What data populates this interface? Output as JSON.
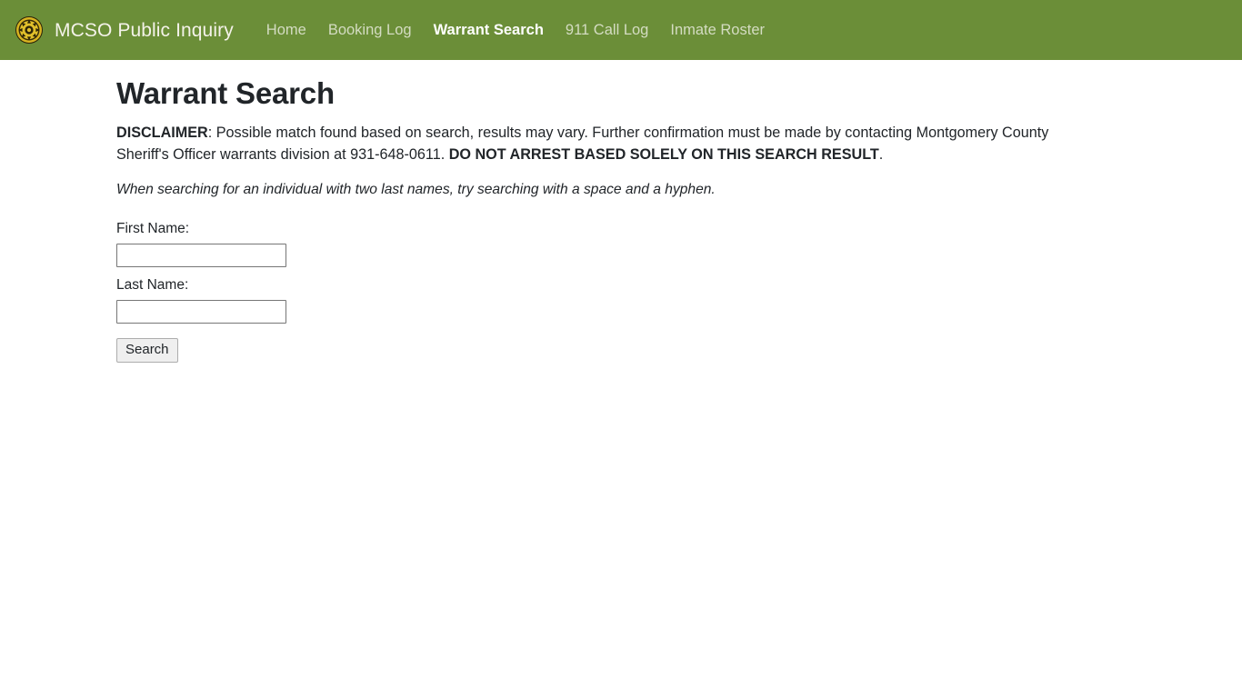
{
  "colors": {
    "navbar_bg": "#6b8e38",
    "brand_text": "#f4f2e9",
    "nav_link": "#d4dcc2",
    "nav_link_active": "#ffffff",
    "logo_gold": "#d8b421",
    "logo_dark": "#2c2408",
    "body_text": "#212529",
    "input_border": "#767676",
    "button_bg": "#efefef"
  },
  "navbar": {
    "brand": "MCSO Public Inquiry",
    "logo_icon": "sheriff-badge-seal-icon",
    "links": [
      {
        "label": "Home",
        "active": false
      },
      {
        "label": "Booking Log",
        "active": false
      },
      {
        "label": "Warrant Search",
        "active": true
      },
      {
        "label": "911 Call Log",
        "active": false
      },
      {
        "label": "Inmate Roster",
        "active": false
      }
    ]
  },
  "main": {
    "title": "Warrant Search",
    "disclaimer": {
      "label": "DISCLAIMER",
      "body_part1": ": Possible match found based on search, results may vary. Further confirmation must be made by contacting Montgomery County Sheriff's Officer warrants division at 931-648-0611. ",
      "warning": "DO NOT ARREST BASED SOLELY ON THIS SEARCH RESULT",
      "body_part2": "."
    },
    "hint": "When searching for an individual with two last names, try searching with a space and a hyphen.",
    "form": {
      "first_name_label": "First Name:",
      "first_name_value": "",
      "first_name_placeholder": "",
      "last_name_label": "Last Name:",
      "last_name_value": "",
      "last_name_placeholder": "",
      "search_button_label": "Search"
    }
  }
}
